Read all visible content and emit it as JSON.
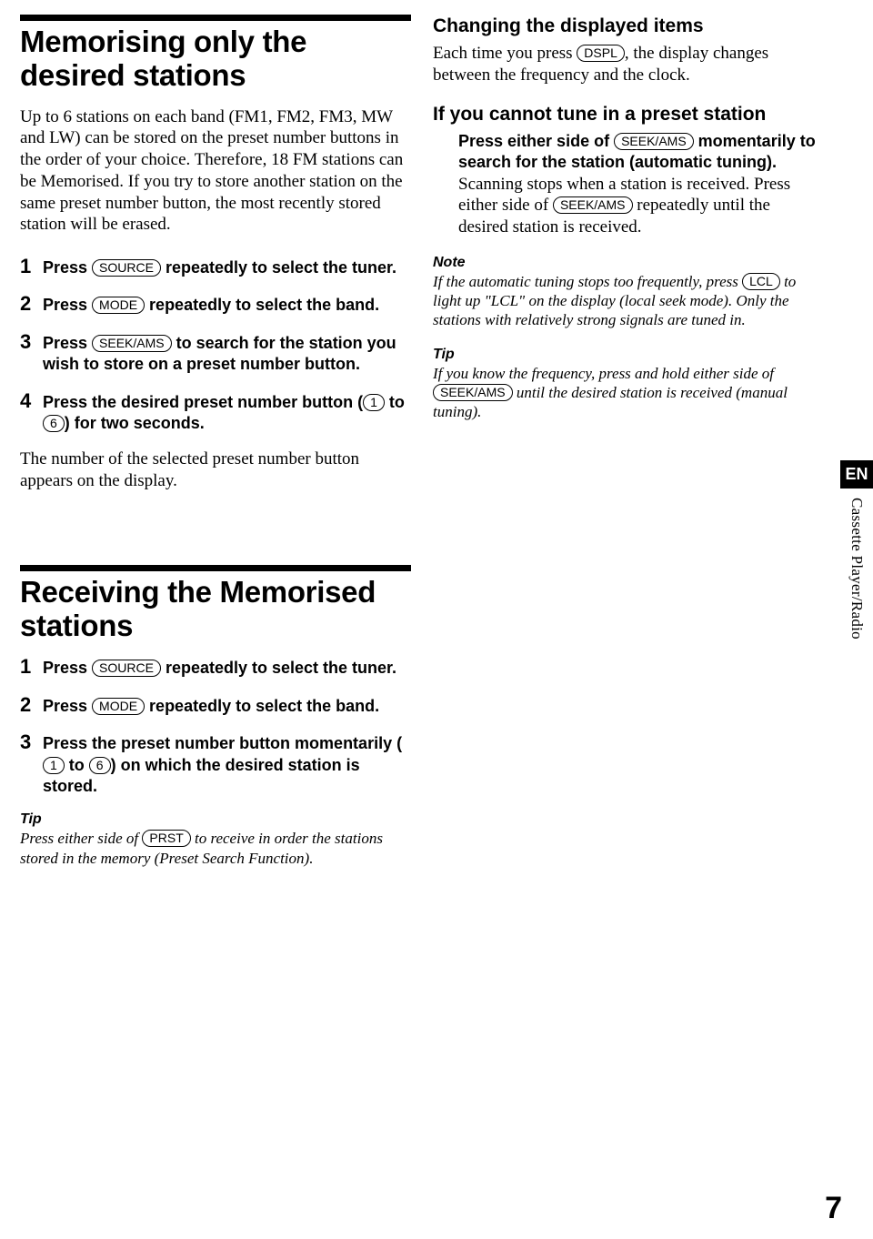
{
  "left": {
    "sec1": {
      "title": "Memorising only the desired stations",
      "intro": "Up to 6 stations on each band (FM1, FM2, FM3, MW and LW) can be stored on the preset number buttons in the order of your choice. Therefore, 18 FM stations can be Memorised. If you try to store another station on the same preset number button, the most recently stored station will be erased.",
      "steps": {
        "s1a": "Press ",
        "s1pill": "SOURCE",
        "s1b": " repeatedly to select the tuner.",
        "s2a": "Press ",
        "s2pill": "MODE",
        "s2b": " repeatedly to select the band.",
        "s3a": "Press ",
        "s3pill": "SEEK/AMS",
        "s3b": " to search for the station you wish to store on a preset number button.",
        "s4a": "Press the desired preset number button (",
        "s4p1": "1",
        "s4mid": " to ",
        "s4p2": "6",
        "s4b": ") for two seconds."
      },
      "after": "The number of the selected preset number button appears on the display."
    },
    "sec2": {
      "title": "Receiving the Memorised stations",
      "steps": {
        "s1a": "Press ",
        "s1pill": "SOURCE",
        "s1b": " repeatedly to select the tuner.",
        "s2a": "Press ",
        "s2pill": "MODE",
        "s2b": " repeatedly to select the band.",
        "s3a": "Press the preset number button momentarily (",
        "s3p1": "1",
        "s3mid": " to ",
        "s3p2": "6",
        "s3b": ") on which the desired station is stored."
      },
      "tip_label": "Tip",
      "tip_a": "Press either side of ",
      "tip_pill": "PRST",
      "tip_b": " to receive in order the stations stored in the memory (Preset Search Function)."
    }
  },
  "right": {
    "sec1": {
      "title": "Changing the displayed items",
      "body_a": "Each time you press ",
      "body_pill": "DSPL",
      "body_b": ", the display changes between the frequency and the clock."
    },
    "sec2": {
      "title": "If you cannot tune in a preset station",
      "bold_a": "Press either side of ",
      "bold_pill": "SEEK/AMS",
      "bold_b": " momentarily to search for the station (automatic tuning).",
      "norm_a": "Scanning stops when a station is received. Press either side of ",
      "norm_pill": "SEEK/AMS",
      "norm_b": " repeatedly until the desired station is received.",
      "note_label": "Note",
      "note_a": "If the automatic tuning stops too frequently, press ",
      "note_pill": "LCL",
      "note_b": " to light up \"LCL\" on the display (local seek mode). Only the stations with relatively strong signals are tuned in.",
      "tip_label": "Tip",
      "tip_a": "If you know the frequency, press and hold either side of ",
      "tip_pill": "SEEK/AMS",
      "tip_b": " until the desired station is received (manual tuning)."
    }
  },
  "side": {
    "en": "EN",
    "section": "Cassette Player/Radio"
  },
  "page_number": "7",
  "nums": {
    "n1": "1",
    "n2": "2",
    "n3": "3",
    "n4": "4"
  }
}
